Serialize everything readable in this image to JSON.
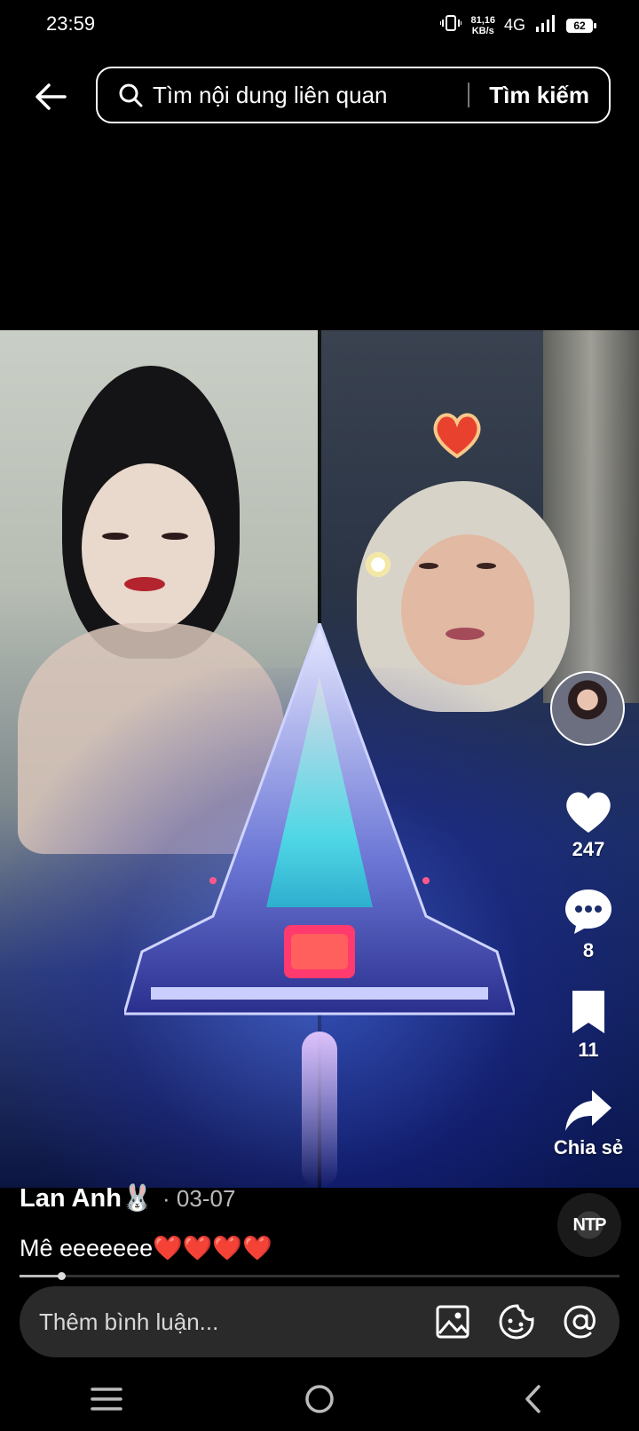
{
  "status_bar": {
    "time": "23:59",
    "net_speed_value": "81,16",
    "net_speed_unit": "KB/s",
    "network": "4G",
    "battery": "62"
  },
  "search": {
    "placeholder": "Tìm nội dung liên quan",
    "button_label": "Tìm kiếm"
  },
  "actions": {
    "likes": "247",
    "comments": "8",
    "saves": "11",
    "share_label": "Chia sẻ"
  },
  "post": {
    "author": "Lan Anh🐰",
    "date": "· 03-07",
    "caption": "Mê eeeeeee❤️❤️❤️❤️",
    "music_badge": "NTP",
    "progress": 0.07
  },
  "comment_bar": {
    "placeholder": "Thêm bình luận..."
  },
  "icons": {
    "back": "arrow-left-icon",
    "search": "search-icon",
    "like": "heart-icon",
    "comment": "chat-bubble-icon",
    "save": "bookmark-icon",
    "share": "share-arrow-icon",
    "image": "image-icon",
    "emoji": "sticker-icon",
    "mention": "at-sign-icon"
  }
}
